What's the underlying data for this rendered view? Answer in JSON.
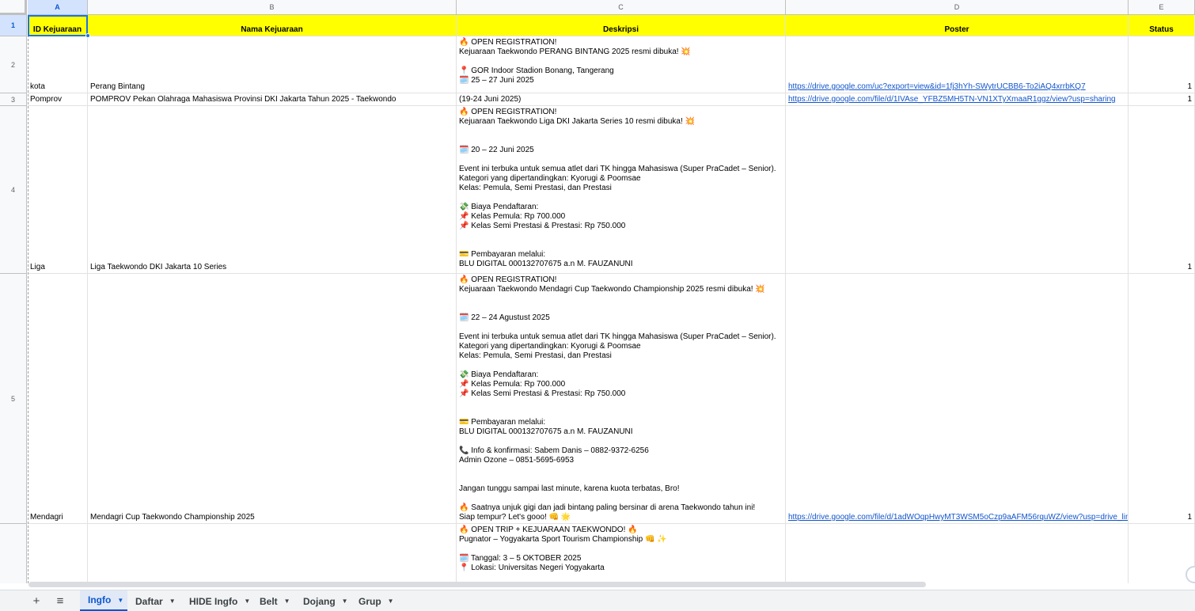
{
  "columns": [
    "A",
    "B",
    "C",
    "D",
    "E"
  ],
  "headers": {
    "row_number": "1",
    "id": "ID Kejuaraan",
    "nama": "Nama Kejuaraan",
    "deskripsi": "Deskripsi",
    "poster": "Poster",
    "status": "Status"
  },
  "rows": [
    {
      "row_number": "2",
      "id": "kota",
      "nama": "Perang Bintang",
      "deskripsi": "🔥 OPEN REGISTRATION!\nKejuaraan Taekwondo PERANG BINTANG 2025 resmi dibuka! 💥\n\n📍 GOR Indoor Stadion Bonang, Tangerang\n🗓️ 25 – 27 Juni 2025",
      "poster": "https://drive.google.com/uc?export=view&id=1fj3hYh-SWytrUCBB6-To2iAQ4xrrbKQ7",
      "status": "1"
    },
    {
      "row_number": "3",
      "id": "Pomprov",
      "nama": "POMPROV Pekan Olahraga Mahasiswa Provinsi DKI Jakarta Tahun 2025 - Taekwondo",
      "deskripsi": "(19-24 Juni 2025)",
      "poster": "https://drive.google.com/file/d/1IVAse_YFBZ5MH5TN-VN1XTyXmaaR1ggz/view?usp=sharing",
      "status": "1"
    },
    {
      "row_number": "4",
      "id": "Liga",
      "nama": "Liga Taekwondo DKI Jakarta 10 Series",
      "deskripsi": "🔥 OPEN REGISTRATION!\nKejuaraan Taekwondo Liga DKI Jakarta Series 10 resmi dibuka! 💥\n\n\n🗓️ 20 – 22 Juni 2025\n\nEvent ini terbuka untuk semua atlet dari TK hingga Mahasiswa (Super PraCadet – Senior).\nKategori yang dipertandingkan: Kyorugi & Poomsae\nKelas: Pemula, Semi Prestasi, dan Prestasi\n\n💸 Biaya Pendaftaran:\n📌 Kelas Pemula: Rp 700.000\n📌 Kelas Semi Prestasi & Prestasi: Rp 750.000\n\n\n💳 Pembayaran melalui:\nBLU DIGITAL 000132707675 a.n M. FAUZANUNI",
      "poster": "",
      "status": "1"
    },
    {
      "row_number": "5",
      "id": "Mendagri",
      "nama": "Mendagri Cup Taekwondo Championship 2025",
      "deskripsi": "🔥 OPEN REGISTRATION!\nKejuaraan Taekwondo Mendagri Cup Taekwondo Championship 2025 resmi dibuka! 💥\n\n\n🗓️ 22 – 24 Agustust 2025\n\nEvent ini terbuka untuk semua atlet dari TK hingga Mahasiswa (Super PraCadet – Senior).\nKategori yang dipertandingkan: Kyorugi & Poomsae\nKelas: Pemula, Semi Prestasi, dan Prestasi\n\n💸 Biaya Pendaftaran:\n📌 Kelas Pemula: Rp 700.000\n📌 Kelas Semi Prestasi & Prestasi: Rp 750.000\n\n\n💳 Pembayaran melalui:\nBLU DIGITAL 000132707675 a.n M. FAUZANUNI\n\n📞 Info & konfirmasi: Sabem Danis – 0882-9372-6256\nAdmin Ozone – 0851-5695-6953\n\n\nJangan tunggu sampai last minute, karena kuota terbatas, Bro!\n\n🔥 Saatnya unjuk gigi dan jadi bintang paling bersinar di arena Taekwondo tahun ini!\nSiap tempur? Let's gooo! 👊 🌟",
      "poster": "https://drive.google.com/file/d/1adWOqpHwyMT3WSM5oCzp9aAFM56rquWZ/view?usp=drive_link",
      "status": "1"
    },
    {
      "row_number": "",
      "id": "",
      "nama": "",
      "deskripsi": "🔥 OPEN TRIP + KEJUARAAN TAEKWONDO! 🔥\nPugnator – Yogyakarta Sport Tourism Championship 👊 ✨\n\n🗓️ Tanggal: 3 – 5 OKTOBER 2025\n📍 Lokasi: Universitas Negeri Yogyakarta",
      "poster": "",
      "status": ""
    }
  ],
  "sheet_tabs": [
    {
      "label": "Ingfo",
      "active": true
    },
    {
      "label": "Daftar",
      "active": false
    },
    {
      "label": "HIDE Ingfo",
      "active": false
    },
    {
      "label": "Belt",
      "active": false
    },
    {
      "label": "Dojang",
      "active": false
    },
    {
      "label": "Grup",
      "active": false
    }
  ],
  "icons": {
    "add_sheet": "plus-icon",
    "all_sheets": "menu-icon",
    "tab_menu": "caret-down-icon"
  },
  "colors": {
    "header_fill": "#ffff00",
    "link": "#1155cc",
    "active_tab": "#0b57d0"
  }
}
